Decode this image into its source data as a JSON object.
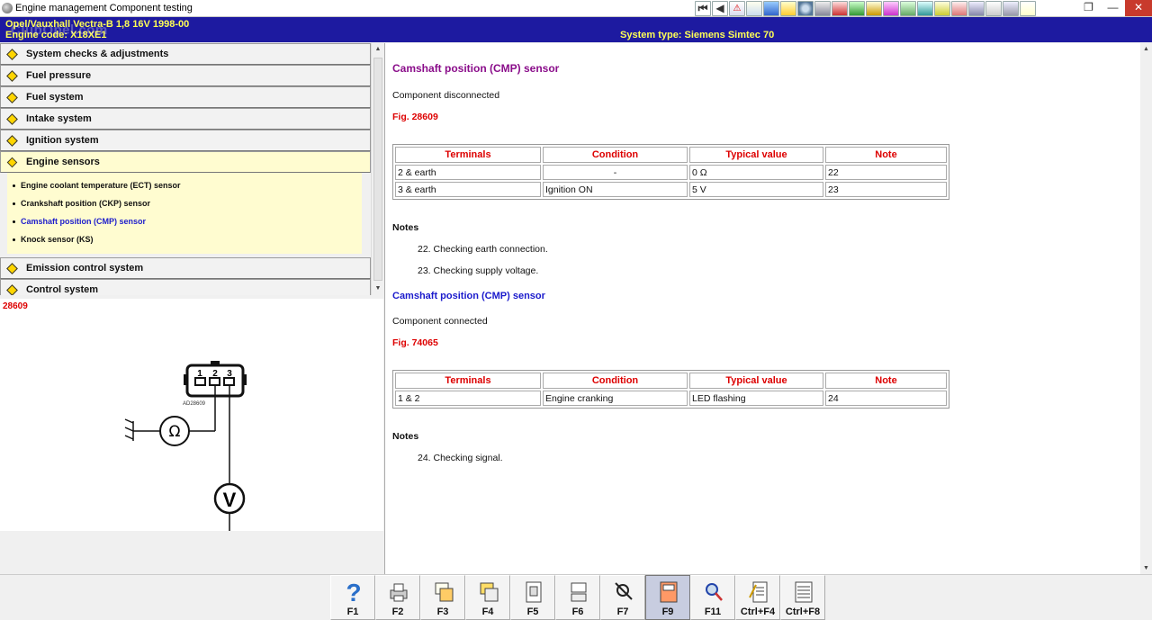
{
  "window": {
    "title": "Engine management Component testing"
  },
  "toolbar": {
    "nav_first": "⏮",
    "nav_prev": "◀",
    "warning": "⚠",
    "icon_names": [
      "photo-icon",
      "tools-icon",
      "oil-can-icon",
      "wheel-icon",
      "gear-icon",
      "book-icon",
      "flag-icon",
      "wiring-icon",
      "wrench-icon",
      "ecu-icon",
      "list-icon",
      "key-icon",
      "print-icon",
      "car-icon",
      "warning-triangle-icon",
      "engine-icon",
      "doc-icon"
    ],
    "window_controls": {
      "restore": "❐",
      "minimize": "—",
      "close": "✕"
    }
  },
  "header": {
    "vehicle": "Opel/Vauxhall   Vectra-B   1,8 16V 1998-00",
    "engine": "Engine code: X18XE1",
    "system_type": "System type: Siemens Simtec 70",
    "watermark": "ClubOpel.com"
  },
  "tree": {
    "categories_top": [
      {
        "label": "System checks & adjustments"
      },
      {
        "label": "Fuel pressure"
      },
      {
        "label": "Fuel system"
      },
      {
        "label": "Intake system"
      },
      {
        "label": "Ignition system"
      },
      {
        "label": "Engine sensors"
      }
    ],
    "sub_items": [
      {
        "label": "Engine coolant temperature (ECT) sensor"
      },
      {
        "label": "Crankshaft position (CKP) sensor"
      },
      {
        "label": "Camshaft position (CMP) sensor"
      },
      {
        "label": "Knock sensor (KS)"
      }
    ],
    "categories_bottom": [
      {
        "label": "Emission control system"
      },
      {
        "label": "Control system"
      }
    ]
  },
  "figure": {
    "number": "28609",
    "connector_pins": [
      "1",
      "2",
      "3"
    ],
    "part_code": "AD28609",
    "ohm_symbol": "Ω",
    "volt_symbol": "V"
  },
  "content": {
    "title1": "Camshaft position (CMP) sensor",
    "state1": "Component disconnected",
    "fig1": "Fig. 28609",
    "table_headers": [
      "Terminals",
      "Condition",
      "Typical value",
      "Note"
    ],
    "table1": [
      [
        "2 & earth",
        "-",
        "0 Ω",
        "22"
      ],
      [
        "3 & earth",
        "Ignition ON",
        "5 V",
        "23"
      ]
    ],
    "notes_label": "Notes",
    "notes1": [
      "22. Checking earth connection.",
      "23. Checking supply voltage."
    ],
    "title2": "Camshaft position (CMP) sensor",
    "state2": "Component connected",
    "fig2": "Fig. 74065",
    "table2": [
      [
        "1 & 2",
        "Engine cranking",
        "LED flashing",
        "24"
      ]
    ],
    "notes2": [
      "24. Checking signal."
    ]
  },
  "fnkeys": [
    "F1",
    "F2",
    "F3",
    "F4",
    "F5",
    "F6",
    "F7",
    "F9",
    "F11",
    "Ctrl+F4",
    "Ctrl+F8"
  ]
}
